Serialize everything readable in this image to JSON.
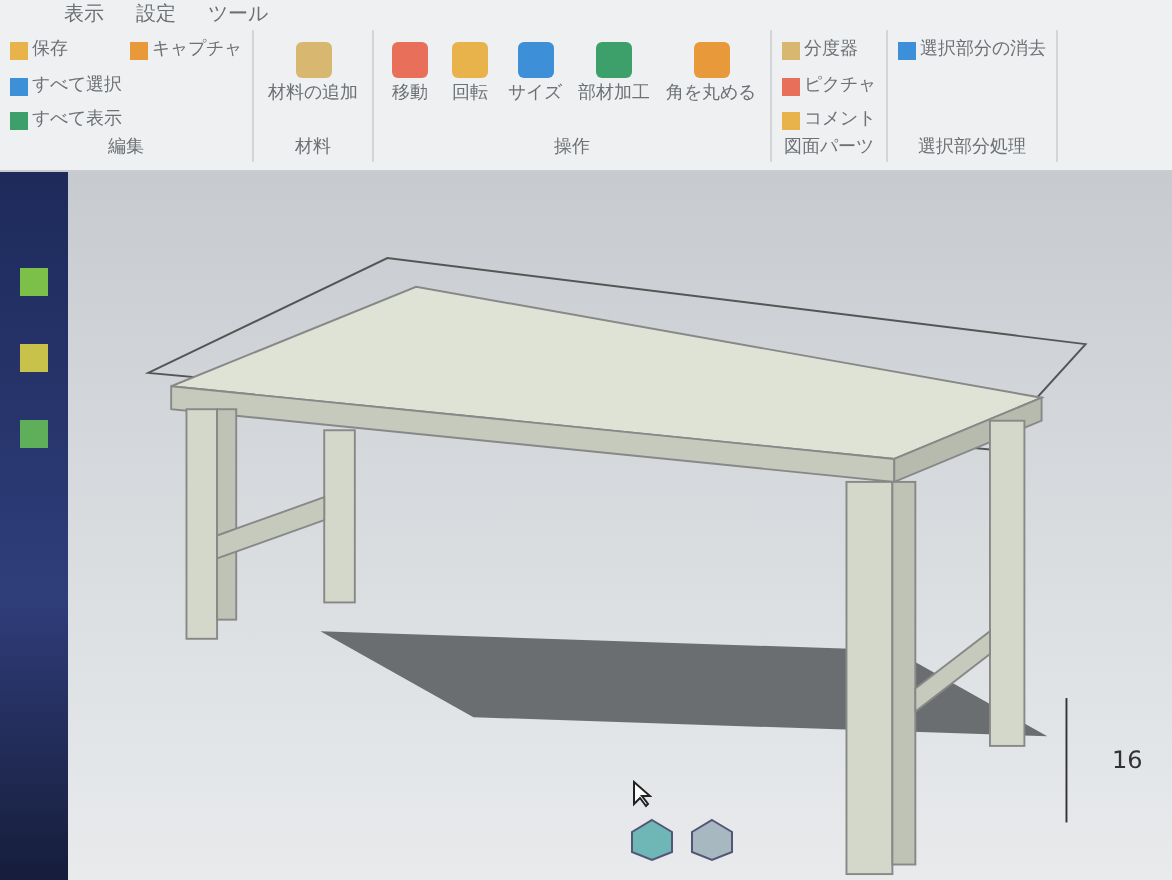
{
  "ribbon": {
    "tabs": [
      {
        "label": "表示"
      },
      {
        "label": "設定"
      },
      {
        "label": "ツール"
      }
    ],
    "groups": [
      {
        "label": "編集",
        "buttons": [
          {
            "label": "保存",
            "kind": "small"
          },
          {
            "label": "すべて選択",
            "kind": "small"
          },
          {
            "label": "すべて表示",
            "kind": "small"
          },
          {
            "label": "キャプチャ",
            "kind": "small"
          }
        ]
      },
      {
        "label": "材料",
        "buttons": [
          {
            "label": "材料の追加",
            "kind": "large"
          }
        ]
      },
      {
        "label": "操作",
        "buttons": [
          {
            "label": "移動",
            "kind": "large"
          },
          {
            "label": "回転",
            "kind": "large"
          },
          {
            "label": "サイズ",
            "kind": "large"
          },
          {
            "label": "部材加工",
            "kind": "large"
          },
          {
            "label": "角を丸める",
            "kind": "large"
          }
        ]
      },
      {
        "label": "図面パーツ",
        "buttons": [
          {
            "label": "分度器",
            "kind": "small"
          },
          {
            "label": "ピクチャ",
            "kind": "small"
          },
          {
            "label": "コメント",
            "kind": "small"
          }
        ]
      },
      {
        "label": "選択部分処理",
        "buttons": [
          {
            "label": "選択部分の消去",
            "kind": "small"
          }
        ]
      }
    ]
  },
  "viewport": {
    "dimension": "16"
  }
}
